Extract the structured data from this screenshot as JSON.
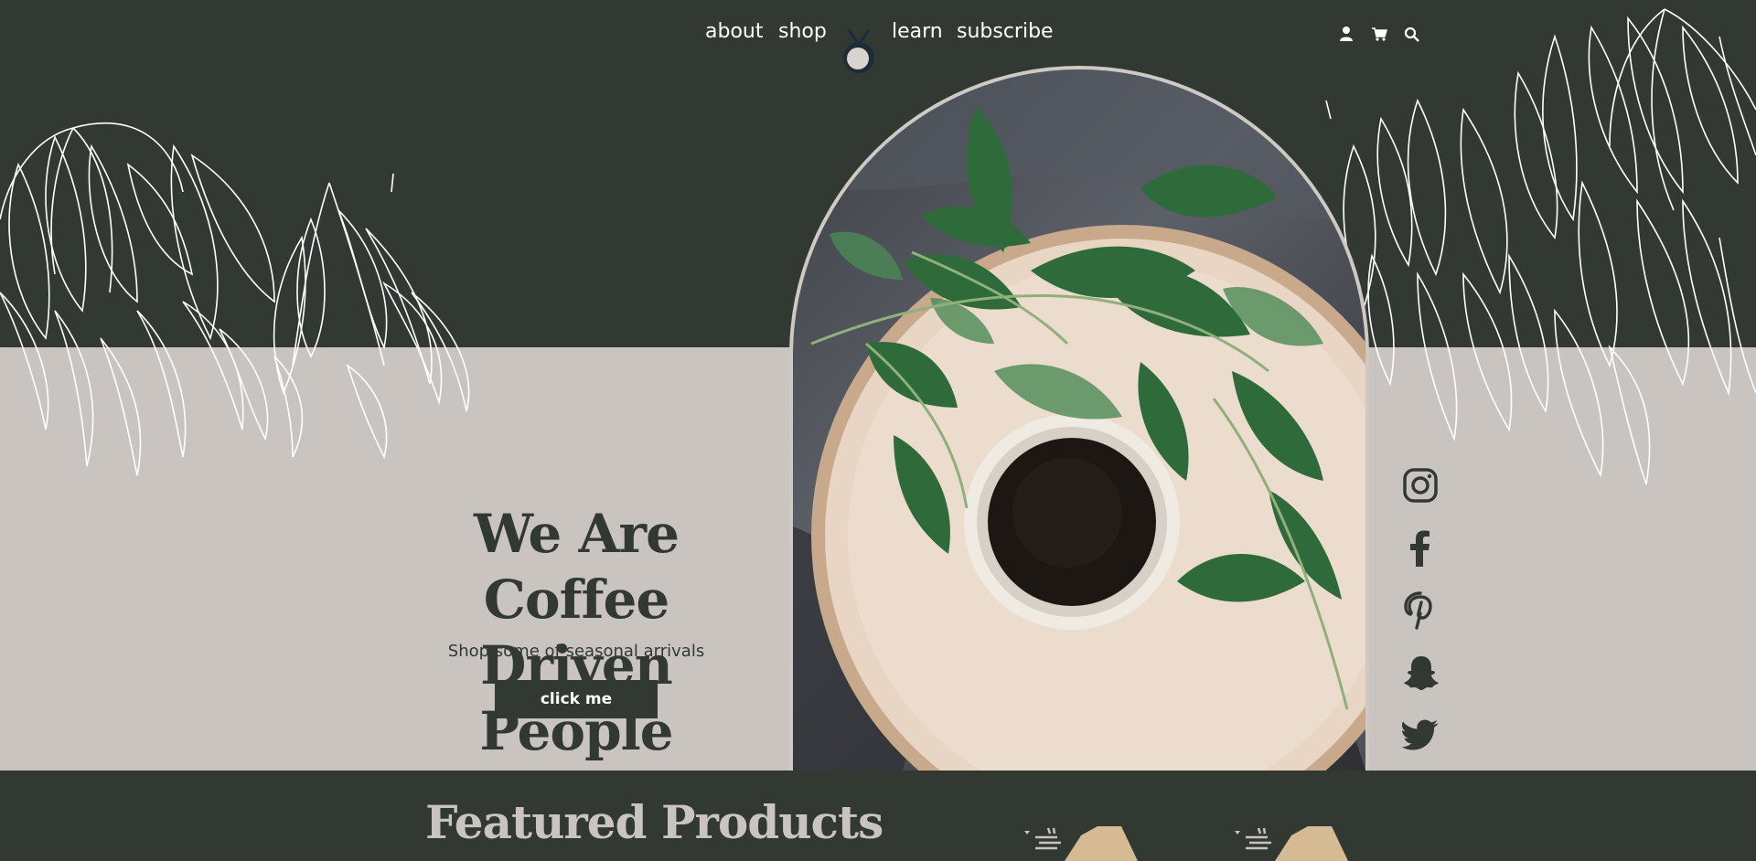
{
  "nav": {
    "links": {
      "about": "about",
      "shop": "shop",
      "learn": "learn",
      "subscribe": "subscribe"
    },
    "icons": [
      "user-icon",
      "cart-icon",
      "search-icon"
    ]
  },
  "hero": {
    "title_line1": "We Are Coffee",
    "title_line2": "Driven People",
    "subtitle": "Shop some of seasonal arrivals",
    "button_label": "click me"
  },
  "social": [
    "instagram-icon",
    "facebook-icon",
    "pinterest-icon",
    "snapchat-icon",
    "twitter-icon"
  ],
  "featured": {
    "title": "Featured Products"
  },
  "colors": {
    "dark_green": "#313932",
    "taupe": "#cac4c1",
    "white": "#ffffff"
  }
}
